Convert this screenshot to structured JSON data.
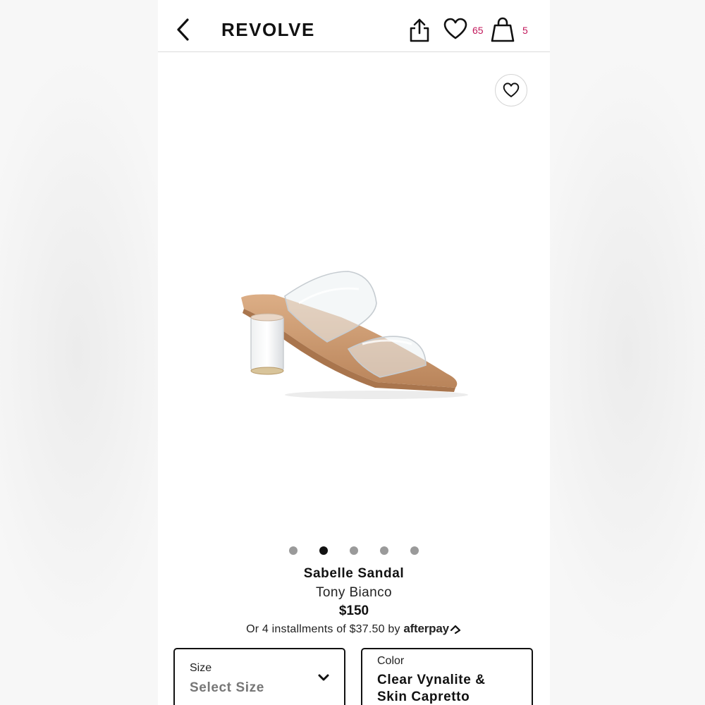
{
  "header": {
    "logo": "REVOLVE",
    "wishlist_count": "65",
    "bag_count": "5"
  },
  "carousel": {
    "total": 5,
    "active_index": 1
  },
  "product": {
    "name": "Sabelle Sandal",
    "brand": "Tony Bianco",
    "price": "$150",
    "installments_text": "Or 4 installments of $37.50 by",
    "afterpay_label": "afterpay"
  },
  "selectors": {
    "size": {
      "label": "Size",
      "value": "Select Size"
    },
    "color": {
      "label": "Color",
      "value": "Clear Vynalite & Skin Capretto"
    }
  },
  "colors": {
    "accent_pink": "#c2185b",
    "sandal_tan": "#d4a077"
  },
  "icons": {
    "back": "chevron-left-icon",
    "share": "share-icon",
    "wishlist": "heart-icon",
    "bag": "shopping-bag-icon",
    "dropdown": "chevron-down-icon"
  }
}
